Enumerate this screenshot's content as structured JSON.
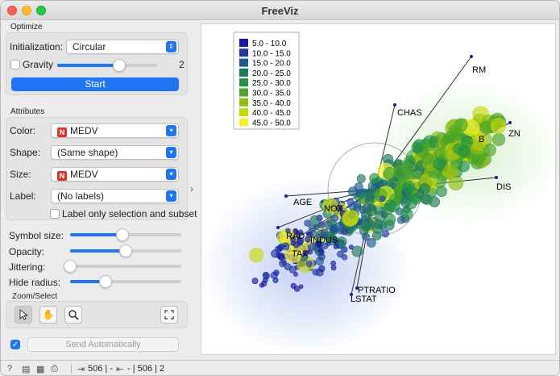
{
  "window": {
    "title": "FreeViz"
  },
  "optimize": {
    "section_title": "Optimize",
    "initialization_label": "Initialization:",
    "initialization_value": "Circular",
    "gravity_label": "Gravity",
    "gravity_checked": false,
    "gravity_value": "2",
    "gravity_fraction": 0.62,
    "start_label": "Start"
  },
  "attributes": {
    "section_title": "Attributes",
    "color_label": "Color:",
    "color_value": "MEDV",
    "shape_label": "Shape:",
    "shape_value": "(Same shape)",
    "size_label": "Size:",
    "size_value": "MEDV",
    "label_label": "Label:",
    "label_value": "(No labels)",
    "label_only_text": "Label only selection and subset",
    "label_only_checked": false,
    "numeric_badge": "N"
  },
  "sliders": {
    "symbol_size_label": "Symbol size:",
    "symbol_size_fraction": 0.47,
    "opacity_label": "Opacity:",
    "opacity_fraction": 0.5,
    "jittering_label": "Jittering:",
    "jittering_fraction": 0.0,
    "hide_radius_label": "Hide radius:",
    "hide_radius_fraction": 0.32
  },
  "zoom_select": {
    "section_title": "Zoom/Select",
    "tools": [
      {
        "name": "select-tool",
        "icon": "arrow-pointer-icon",
        "active": true
      },
      {
        "name": "pan-tool",
        "icon": "hand-icon",
        "active": false
      },
      {
        "name": "zoom-tool",
        "icon": "magnifier-icon",
        "active": false
      }
    ],
    "fit_icon": "fit-view-icon"
  },
  "send": {
    "auto_checked": true,
    "label": "Send Automatically"
  },
  "legend": {
    "entries": [
      {
        "label": "5.0 - 10.0",
        "color": "#1a1aa0"
      },
      {
        "label": "10.0 - 15.0",
        "color": "#1f3b9e"
      },
      {
        "label": "15.0 - 20.0",
        "color": "#1f5a8c"
      },
      {
        "label": "20.0 - 25.0",
        "color": "#1d7a5c"
      },
      {
        "label": "25.0 - 30.0",
        "color": "#239044"
      },
      {
        "label": "30.0 - 35.0",
        "color": "#4aa52a"
      },
      {
        "label": "35.0 - 40.0",
        "color": "#8cbc16"
      },
      {
        "label": "40.0 - 45.0",
        "color": "#c8d80a"
      },
      {
        "label": "45.0 - 50.0",
        "color": "#f2f230"
      }
    ]
  },
  "anchors": {
    "labels": [
      "RM",
      "ZN",
      "CHAS",
      "B",
      "DIS",
      "AGE",
      "NOX",
      "RAD",
      "INDUS",
      "TAX",
      "PTRATIO",
      "LSTAT"
    ]
  },
  "status": {
    "input_count": "506 | -",
    "output_count": "- | 506 | 2"
  }
}
